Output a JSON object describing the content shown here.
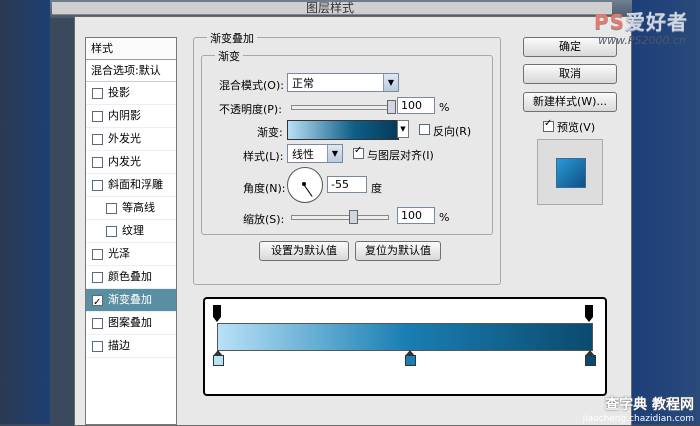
{
  "window": {
    "title": "图层样式"
  },
  "watermark": {
    "brand_a": "PS",
    "brand_b": "爱好者",
    "url": "www.PS2000.cn",
    "bottom": "查字典 教程网",
    "bottom_url": "jiaocheng.chazidian.com"
  },
  "style_list": {
    "header": "样式",
    "blend_options": "混合选项:默认",
    "items": [
      {
        "label": "投影",
        "checked": false
      },
      {
        "label": "内阴影",
        "checked": false
      },
      {
        "label": "外发光",
        "checked": false
      },
      {
        "label": "内发光",
        "checked": false
      },
      {
        "label": "斜面和浮雕",
        "checked": false
      },
      {
        "label": "等高线",
        "checked": false
      },
      {
        "label": "纹理",
        "checked": false
      },
      {
        "label": "光泽",
        "checked": false
      },
      {
        "label": "颜色叠加",
        "checked": false
      },
      {
        "label": "渐变叠加",
        "checked": true
      },
      {
        "label": "图案叠加",
        "checked": false
      },
      {
        "label": "描边",
        "checked": false
      }
    ]
  },
  "panel": {
    "group_title": "渐变叠加",
    "sub_title": "渐变",
    "blend_mode_label": "混合模式(O):",
    "blend_mode_value": "正常",
    "opacity_label": "不透明度(P):",
    "opacity_value": "100",
    "opacity_unit": "%",
    "opacity_level": 1.0,
    "gradient_label": "渐变:",
    "reverse_label": "反向(R)",
    "style_label": "样式(L):",
    "style_value": "线性",
    "align_label": "与图层对齐(I)",
    "angle_label": "角度(N):",
    "angle_value": "-55",
    "angle_unit": "度",
    "scale_label": "缩放(S):",
    "scale_value": "100",
    "scale_unit": "%",
    "set_default": "设置为默认值",
    "reset_default": "复位为默认值"
  },
  "buttons": {
    "ok": "确定",
    "cancel": "取消",
    "new_style": "新建样式(W)...",
    "preview": "预览(V)"
  },
  "colors": {
    "gradient_start": "#b8e0f6",
    "gradient_mid": "#1a7fb3",
    "gradient_end": "#063a59",
    "active_item": "#5a8fa3"
  }
}
